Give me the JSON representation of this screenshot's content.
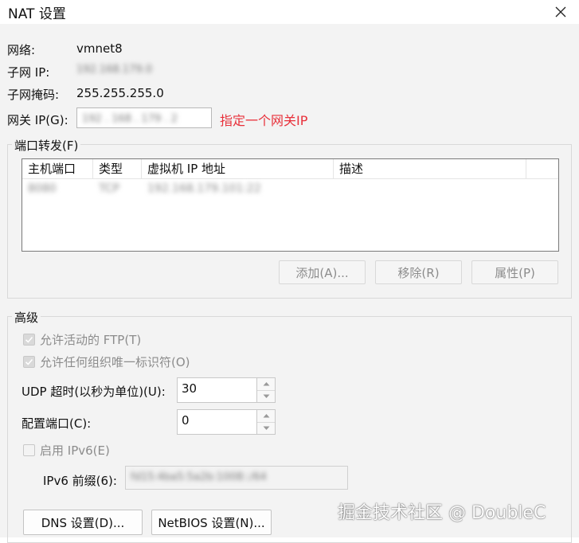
{
  "window": {
    "title": "NAT 设置"
  },
  "info": {
    "network_label": "网络:",
    "network_value": "vmnet8",
    "subnet_ip_label": "子网 IP:",
    "subnet_ip_value": "192.168.179.0",
    "subnet_mask_label": "子网掩码:",
    "subnet_mask_value": "255.255.255.0",
    "gateway_label": "网关 IP(G):",
    "gateway_value": "192 . 168 . 179 . 2",
    "annotation": "指定一个网关IP"
  },
  "port_forwarding": {
    "title": "端口转发(F)",
    "columns": [
      "主机端口",
      "类型",
      "虚拟机 IP 地址",
      "描述"
    ],
    "rows": [
      {
        "host_port": "8080",
        "type": "TCP",
        "vm_ip": "192.168.179.101:22",
        "description": ""
      }
    ],
    "buttons": {
      "add": "添加(A)...",
      "remove": "移除(R)",
      "properties": "属性(P)"
    }
  },
  "advanced": {
    "title": "高级",
    "allow_ftp_label": "允许活动的 FTP(T)",
    "allow_ftp_checked": true,
    "allow_ouid_label": "允许任何组织唯一标识符(O)",
    "allow_ouid_checked": true,
    "udp_timeout_label": "UDP 超时(以秒为单位)(U):",
    "udp_timeout_value": "30",
    "config_port_label": "配置端口(C):",
    "config_port_value": "0",
    "enable_ipv6_label": "启用 IPv6(E)",
    "enable_ipv6_checked": false,
    "ipv6_prefix_label": "IPv6 前缀(6):",
    "ipv6_prefix_value": "fd15:4ba5:5a2b:1008::/64"
  },
  "footer": {
    "dns_button": "DNS 设置(D)...",
    "netbios_button": "NetBIOS 设置(N)..."
  },
  "watermark": "掘金技术社区 @ DoubleC",
  "colors": {
    "annotation": "#e8303a",
    "background": "#f3f3f3"
  },
  "icons": {
    "close": "close-icon",
    "checkmark": "checkmark-icon",
    "spin_up": "chevron-up-icon",
    "spin_down": "chevron-down-icon"
  }
}
